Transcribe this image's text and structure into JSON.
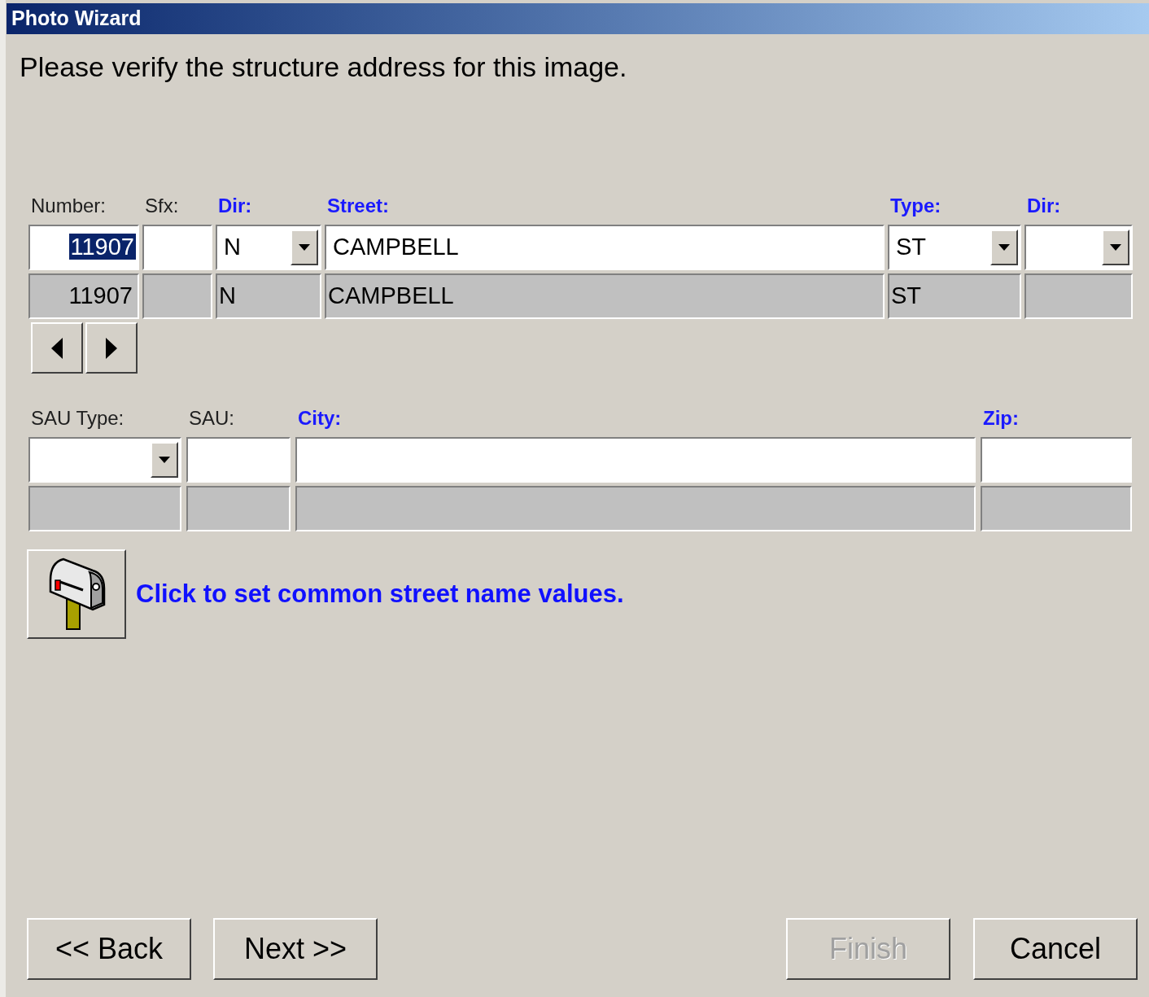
{
  "window": {
    "title": "Photo Wizard"
  },
  "instruction": "Please verify the structure address for this image.",
  "address_fields": [
    {
      "label": "Number:",
      "required": false,
      "kind": "number",
      "value": "11907",
      "highlighted": true,
      "reference": "11907"
    },
    {
      "label": "Sfx:",
      "required": false,
      "kind": "text"
    },
    {
      "label": "Dir:",
      "required": true,
      "kind": "dropdown",
      "value": "N",
      "highlighted": false,
      "reference": "N"
    },
    {
      "label": "Street:",
      "required": true,
      "kind": "text",
      "value": "CAMPBELL",
      "highlighted": false,
      "reference": "CAMPBELL"
    },
    {
      "label": "Type:",
      "required": true,
      "kind": "dropdown",
      "value": "ST",
      "highlighted": false,
      "reference": "ST"
    },
    {
      "label": "Dir:",
      "required": true,
      "kind": "dropdown"
    }
  ],
  "location_fields": [
    {
      "label": "SAU Type:",
      "required": false,
      "kind": "dropdown"
    },
    {
      "label": "SAU:",
      "required": false,
      "kind": "text"
    },
    {
      "label": "City:",
      "required": true,
      "kind": "text"
    },
    {
      "label": "Zip:",
      "required": true,
      "kind": "text"
    }
  ],
  "common_values_link": "Click to set common street name values.",
  "buttons": [
    {
      "label": "<< Back",
      "disabled": false
    },
    {
      "label": "Next >>",
      "disabled": false
    },
    {
      "label": "Finish",
      "disabled": true
    },
    {
      "label": "Cancel",
      "disabled": false
    }
  ]
}
